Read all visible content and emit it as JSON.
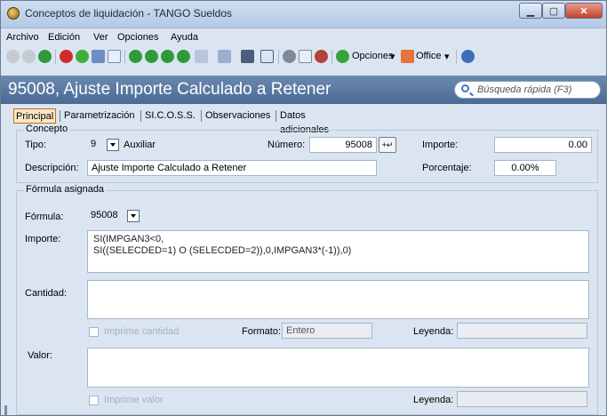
{
  "window": {
    "title": "Conceptos de liquidación - TANGO Sueldos"
  },
  "menu": [
    "Archivo",
    "Edición",
    "Ver",
    "Opciones",
    "Ayuda"
  ],
  "toolbar": {
    "opciones_label": "Opciones",
    "office_label": "Office"
  },
  "header": {
    "title": "95008, Ajuste Importe Calculado a Retener",
    "search_placeholder": "Búsqueda rápida (F3)"
  },
  "tabs": [
    "Principal",
    "Parametrización",
    "SI.C.O.S.S.",
    "Observaciones",
    "Datos adicionales"
  ],
  "concepto": {
    "group_label": "Concepto",
    "tipo_label": "Tipo:",
    "tipo_value": "9",
    "tipo_text": "Auxiliar",
    "numero_label": "Número:",
    "numero_value": "95008",
    "importe_label": "Importe:",
    "importe_value": "0.00",
    "descripcion_label": "Descripción:",
    "descripcion_value": "Ajuste Importe Calculado a Retener",
    "porcentaje_label": "Porcentaje:",
    "porcentaje_value": "0.00%"
  },
  "formula": {
    "group_label": "Fórmula asignada",
    "formula_label": "Fórmula:",
    "formula_value": "95008",
    "importe_label": "Importe:",
    "importe_line1": "SI(IMPGAN3<0,",
    "importe_line2": "SI((SELECDED=1) O (SELECDED=2)),0,IMPGAN3*(-1)),0)",
    "cantidad_label": "Cantidad:",
    "imprime_cantidad": "Imprime cantidad",
    "formato_label": "Formato:",
    "formato_value": "Entero",
    "leyenda_label": "Leyenda:",
    "valor_label": "Valor:",
    "imprime_valor": "Imprime valor",
    "leyenda2_label": "Leyenda:"
  }
}
